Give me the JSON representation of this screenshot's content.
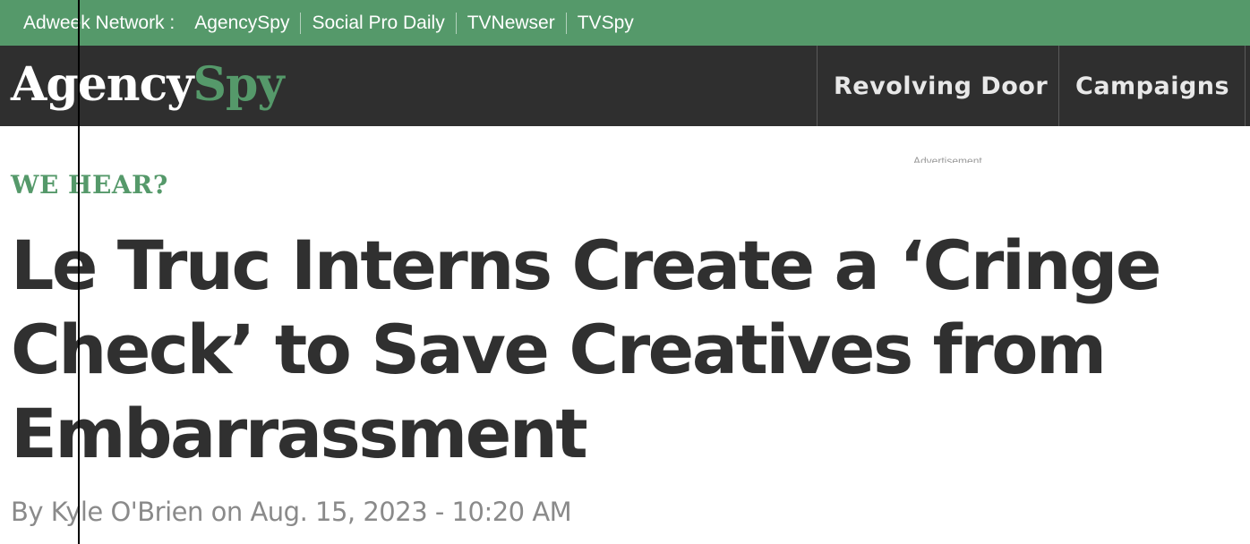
{
  "network_bar": {
    "label": "Adweek Network :",
    "links": [
      "AgencySpy",
      "Social Pro Daily",
      "TVNewser",
      "TVSpy"
    ]
  },
  "header": {
    "logo": {
      "part1": "Agency",
      "part2": "Spy"
    },
    "nav": [
      "Revolving Door",
      "Campaigns"
    ]
  },
  "ad_label": "Advertisement",
  "article": {
    "kicker": "WE HEAR?",
    "headline": "Le Truc Interns Create a ‘Cringe Check’ to Save Creatives from Embarrassment",
    "byline": {
      "prefix": "By ",
      "author": "Kyle O'Brien",
      "middle": " on ",
      "date": "Aug. 15, 2023 - 10:20 AM"
    }
  },
  "colors": {
    "brand_green": "#55996a",
    "header_dark": "#2f2f2f",
    "headline_text": "#303030",
    "byline_text": "#8a8a8a"
  }
}
